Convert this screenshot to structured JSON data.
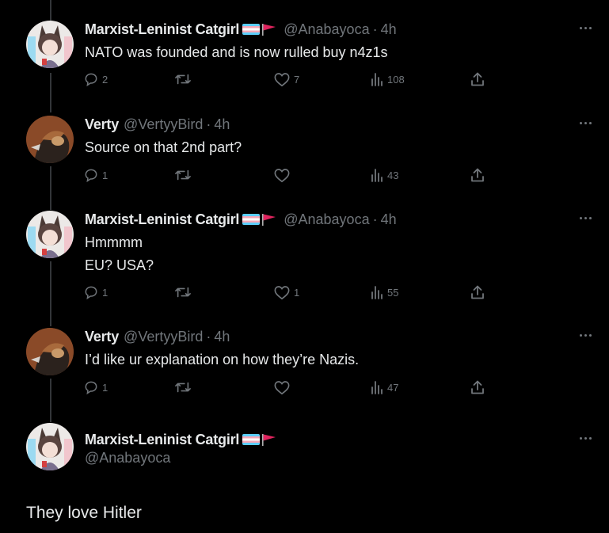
{
  "tweets": [
    {
      "display_name": "Marxist-Leninist Catgirl",
      "has_flags": true,
      "handle": "@Anabayoca",
      "dot": "·",
      "time": "4h",
      "lines": [
        "NATO was founded and is now rulled buy n4z1s"
      ],
      "replies": "2",
      "retweets": "",
      "likes": "7",
      "views": "108"
    },
    {
      "display_name": "Verty",
      "has_flags": false,
      "handle": "@VertyyBird",
      "dot": "·",
      "time": "4h",
      "lines": [
        "Source on that 2nd part?"
      ],
      "replies": "1",
      "retweets": "",
      "likes": "",
      "views": "43"
    },
    {
      "display_name": "Marxist-Leninist Catgirl",
      "has_flags": true,
      "handle": "@Anabayoca",
      "dot": "·",
      "time": "4h",
      "lines": [
        "Hmmmm",
        "EU? USA?"
      ],
      "replies": "1",
      "retweets": "",
      "likes": "1",
      "views": "55"
    },
    {
      "display_name": "Verty",
      "has_flags": false,
      "handle": "@VertyyBird",
      "dot": "·",
      "time": "4h",
      "lines": [
        "I’d like ur explanation on how they’re Nazis."
      ],
      "replies": "1",
      "retweets": "",
      "likes": "",
      "views": "47"
    }
  ],
  "focal_tweet": {
    "display_name": "Marxist-Leninist Catgirl",
    "has_flags": true,
    "handle": "@Anabayoca",
    "text": "They love Hitler"
  },
  "colors": {
    "background": "#000000",
    "primary_text": "#e7e9ea",
    "secondary_text": "#71767b",
    "thread_line": "#333639",
    "trans_flag_blue": "#5bcefa",
    "trans_flag_pink": "#f5a9b8",
    "red_flag": "#e0245e"
  },
  "icons": [
    "reply-icon",
    "retweet-icon",
    "like-icon",
    "views-icon",
    "share-icon",
    "more-icon",
    "trans-flag-icon",
    "red-flag-icon"
  ]
}
